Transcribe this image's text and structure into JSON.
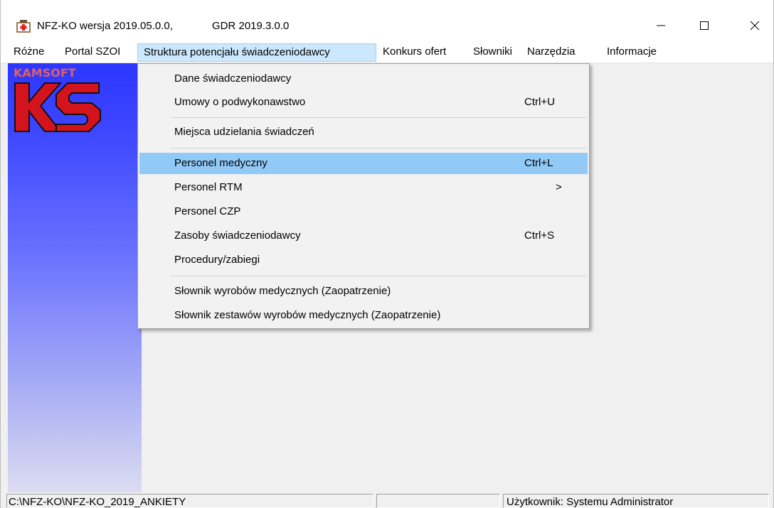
{
  "window": {
    "title": "NFZ-KO wersja 2019.05.0.0,",
    "gdr": "GDR 2019.3.0.0"
  },
  "menubar": {
    "items": [
      {
        "label": "Różne"
      },
      {
        "label": "Portal SZOI"
      },
      {
        "label": "Struktura potencjału świadczeniodawcy"
      },
      {
        "label": "Konkurs ofert"
      },
      {
        "label": "Słowniki"
      },
      {
        "label": "Narzędzia"
      },
      {
        "label": "Informacje"
      }
    ]
  },
  "dropdown": {
    "items": [
      {
        "label": "Dane świadczeniodawcy",
        "shortcut": ""
      },
      {
        "label": "Umowy o podwykonawstwo",
        "shortcut": "Ctrl+U"
      },
      {
        "label": "Miejsca udzielania świadczeń",
        "shortcut": ""
      },
      {
        "label": "Personel medyczny",
        "shortcut": "Ctrl+L"
      },
      {
        "label": "Personel RTM",
        "shortcut": "",
        "submenu": ">"
      },
      {
        "label": "Personel CZP",
        "shortcut": ""
      },
      {
        "label": "Zasoby świadczeniodawcy",
        "shortcut": "Ctrl+S"
      },
      {
        "label": "Procedury/zabiegi",
        "shortcut": ""
      },
      {
        "label": "Słownik wyrobów medycznych (Zaopatrzenie)",
        "shortcut": ""
      },
      {
        "label": "Słownik zestawów wyrobów medycznych (Zaopatrzenie)",
        "shortcut": ""
      }
    ]
  },
  "banner": {
    "logo_text": "KAMSOFT"
  },
  "statusbar": {
    "path": "C:\\NFZ-KO\\NFZ-KO_2019_ANKIETY",
    "middle": "",
    "user": "Użytkownik: Systemu Administrator"
  },
  "colors": {
    "menu_highlight": "#91c9f7",
    "menubar_active": "#cce8ff",
    "banner_top": "#2d36ff",
    "logo_red": "#d4141c"
  }
}
